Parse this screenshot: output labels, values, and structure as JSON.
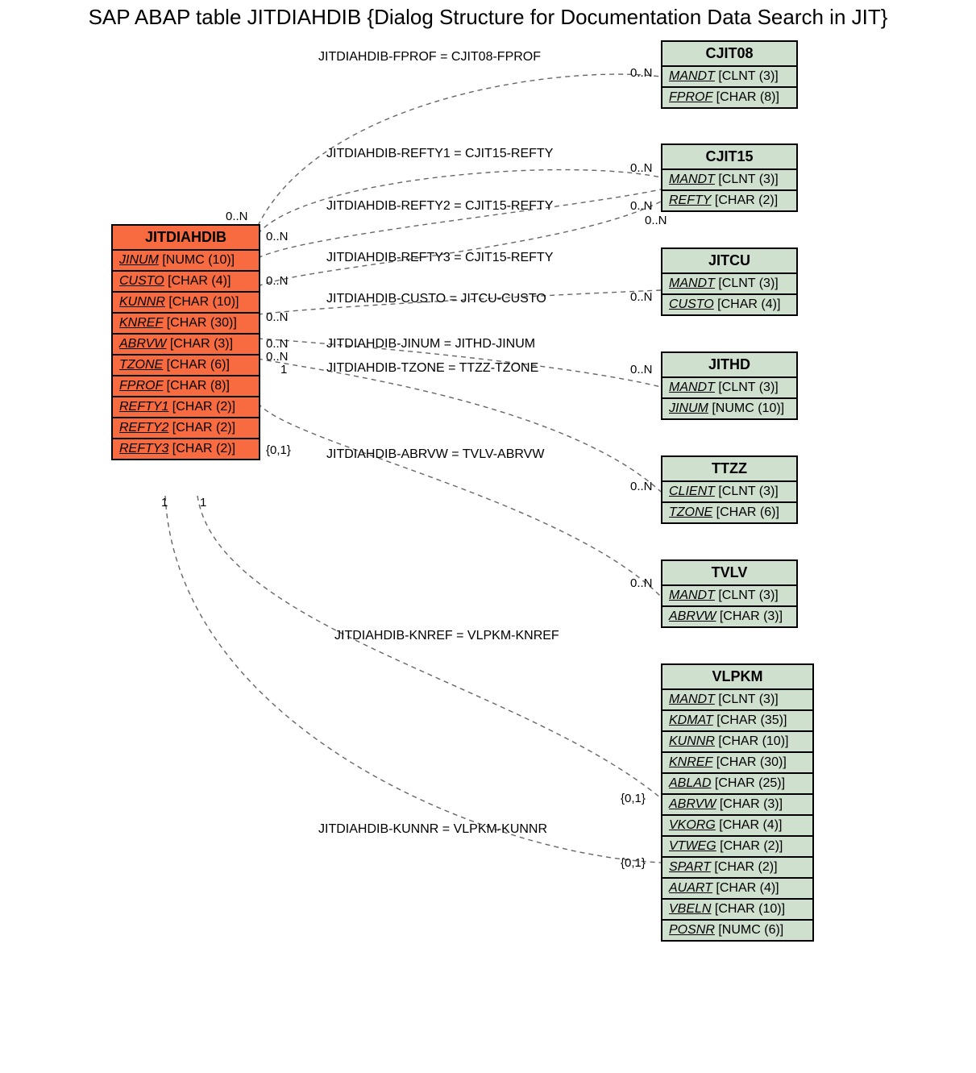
{
  "chart_data": {
    "type": "table",
    "title": "SAP ABAP table JITDIAHDIB {Dialog Structure for Documentation Data Search in JIT}",
    "main_entity": {
      "name": "JITDIAHDIB",
      "fields": [
        {
          "name": "JINUM",
          "type": "NUMC (10)"
        },
        {
          "name": "CUSTO",
          "type": "CHAR (4)"
        },
        {
          "name": "KUNNR",
          "type": "CHAR (10)"
        },
        {
          "name": "KNREF",
          "type": "CHAR (30)"
        },
        {
          "name": "ABRVW",
          "type": "CHAR (3)"
        },
        {
          "name": "TZONE",
          "type": "CHAR (6)"
        },
        {
          "name": "FPROF",
          "type": "CHAR (8)"
        },
        {
          "name": "REFTY1",
          "type": "CHAR (2)"
        },
        {
          "name": "REFTY2",
          "type": "CHAR (2)"
        },
        {
          "name": "REFTY3",
          "type": "CHAR (2)"
        }
      ]
    },
    "related_entities": [
      {
        "name": "CJIT08",
        "fields": [
          {
            "name": "MANDT",
            "type": "CLNT (3)"
          },
          {
            "name": "FPROF",
            "type": "CHAR (8)"
          }
        ]
      },
      {
        "name": "CJIT15",
        "fields": [
          {
            "name": "MANDT",
            "type": "CLNT (3)"
          },
          {
            "name": "REFTY",
            "type": "CHAR (2)"
          }
        ]
      },
      {
        "name": "JITCU",
        "fields": [
          {
            "name": "MANDT",
            "type": "CLNT (3)"
          },
          {
            "name": "CUSTO",
            "type": "CHAR (4)"
          }
        ]
      },
      {
        "name": "JITHD",
        "fields": [
          {
            "name": "MANDT",
            "type": "CLNT (3)"
          },
          {
            "name": "JINUM",
            "type": "NUMC (10)"
          }
        ]
      },
      {
        "name": "TTZZ",
        "fields": [
          {
            "name": "CLIENT",
            "type": "CLNT (3)"
          },
          {
            "name": "TZONE",
            "type": "CHAR (6)"
          }
        ]
      },
      {
        "name": "TVLV",
        "fields": [
          {
            "name": "MANDT",
            "type": "CLNT (3)"
          },
          {
            "name": "ABRVW",
            "type": "CHAR (3)"
          }
        ]
      },
      {
        "name": "VLPKM",
        "fields": [
          {
            "name": "MANDT",
            "type": "CLNT (3)"
          },
          {
            "name": "KDMAT",
            "type": "CHAR (35)"
          },
          {
            "name": "KUNNR",
            "type": "CHAR (10)"
          },
          {
            "name": "KNREF",
            "type": "CHAR (30)"
          },
          {
            "name": "ABLAD",
            "type": "CHAR (25)"
          },
          {
            "name": "ABRVW",
            "type": "CHAR (3)"
          },
          {
            "name": "VKORG",
            "type": "CHAR (4)"
          },
          {
            "name": "VTWEG",
            "type": "CHAR (2)"
          },
          {
            "name": "SPART",
            "type": "CHAR (2)"
          },
          {
            "name": "AUART",
            "type": "CHAR (4)"
          },
          {
            "name": "VBELN",
            "type": "CHAR (10)"
          },
          {
            "name": "POSNR",
            "type": "NUMC (6)"
          }
        ]
      }
    ],
    "relations": [
      {
        "label": "JITDIAHDIB-FPROF = CJIT08-FPROF",
        "left_card": "0..N",
        "right_card": "0..N"
      },
      {
        "label": "JITDIAHDIB-REFTY1 = CJIT15-REFTY",
        "left_card": "0..N",
        "right_card": "0..N"
      },
      {
        "label": "JITDIAHDIB-REFTY2 = CJIT15-REFTY",
        "left_card": "0..N",
        "right_card": "0..N"
      },
      {
        "label": "JITDIAHDIB-REFTY3 = CJIT15-REFTY",
        "left_card": "",
        "right_card": "0..N"
      },
      {
        "label": "JITDIAHDIB-CUSTO = JITCU-CUSTO",
        "left_card": "0..N",
        "right_card": "0..N"
      },
      {
        "label": "JITDIAHDIB-JINUM = JITHD-JINUM",
        "left_card": "0..N",
        "right_card": "0..N"
      },
      {
        "label": "JITDIAHDIB-TZONE = TTZZ-TZONE",
        "left_card": "1",
        "right_card": "0..N"
      },
      {
        "label": "JITDIAHDIB-ABRVW = TVLV-ABRVW",
        "left_card": "{0,1}",
        "right_card": "0..N"
      },
      {
        "label": "JITDIAHDIB-KNREF = VLPKM-KNREF",
        "left_card": "1",
        "right_card": "{0,1}"
      },
      {
        "label": "JITDIAHDIB-KUNNR = VLPKM-KUNNR",
        "left_card": "1",
        "right_card": "{0,1}"
      }
    ]
  },
  "title": "SAP ABAP table JITDIAHDIB {Dialog Structure for Documentation Data Search in JIT}",
  "main": {
    "name": "JITDIAHDIB",
    "rows": [
      {
        "f": "JINUM",
        "t": "[NUMC (10)]"
      },
      {
        "f": "CUSTO",
        "t": "[CHAR (4)]"
      },
      {
        "f": "KUNNR",
        "t": "[CHAR (10)]"
      },
      {
        "f": "KNREF",
        "t": "[CHAR (30)]"
      },
      {
        "f": "ABRVW",
        "t": "[CHAR (3)]"
      },
      {
        "f": "TZONE",
        "t": "[CHAR (6)]"
      },
      {
        "f": "FPROF",
        "t": "[CHAR (8)]"
      },
      {
        "f": "REFTY1",
        "t": "[CHAR (2)]"
      },
      {
        "f": "REFTY2",
        "t": "[CHAR (2)]"
      },
      {
        "f": "REFTY3",
        "t": "[CHAR (2)]"
      }
    ]
  },
  "ent": {
    "cjit08": {
      "name": "CJIT08",
      "rows": [
        {
          "f": "MANDT",
          "t": "[CLNT (3)]"
        },
        {
          "f": "FPROF",
          "t": "[CHAR (8)]"
        }
      ]
    },
    "cjit15": {
      "name": "CJIT15",
      "rows": [
        {
          "f": "MANDT",
          "t": "[CLNT (3)]"
        },
        {
          "f": "REFTY",
          "t": "[CHAR (2)]"
        }
      ]
    },
    "jitcu": {
      "name": "JITCU",
      "rows": [
        {
          "f": "MANDT",
          "t": "[CLNT (3)]"
        },
        {
          "f": "CUSTO",
          "t": "[CHAR (4)]"
        }
      ]
    },
    "jithd": {
      "name": "JITHD",
      "rows": [
        {
          "f": "MANDT",
          "t": "[CLNT (3)]"
        },
        {
          "f": "JINUM",
          "t": "[NUMC (10)]"
        }
      ]
    },
    "ttzz": {
      "name": "TTZZ",
      "rows": [
        {
          "f": "CLIENT",
          "t": "[CLNT (3)]"
        },
        {
          "f": "TZONE",
          "t": "[CHAR (6)]"
        }
      ]
    },
    "tvlv": {
      "name": "TVLV",
      "rows": [
        {
          "f": "MANDT",
          "t": "[CLNT (3)]"
        },
        {
          "f": "ABRVW",
          "t": "[CHAR (3)]"
        }
      ]
    },
    "vlpkm": {
      "name": "VLPKM",
      "rows": [
        {
          "f": "MANDT",
          "t": "[CLNT (3)]"
        },
        {
          "f": "KDMAT",
          "t": "[CHAR (35)]"
        },
        {
          "f": "KUNNR",
          "t": "[CHAR (10)]"
        },
        {
          "f": "KNREF",
          "t": "[CHAR (30)]"
        },
        {
          "f": "ABLAD",
          "t": "[CHAR (25)]"
        },
        {
          "f": "ABRVW",
          "t": "[CHAR (3)]"
        },
        {
          "f": "VKORG",
          "t": "[CHAR (4)]"
        },
        {
          "f": "VTWEG",
          "t": "[CHAR (2)]"
        },
        {
          "f": "SPART",
          "t": "[CHAR (2)]"
        },
        {
          "f": "AUART",
          "t": "[CHAR (4)]"
        },
        {
          "f": "VBELN",
          "t": "[CHAR (10)]"
        },
        {
          "f": "POSNR",
          "t": "[NUMC (6)]"
        }
      ]
    }
  },
  "rel": {
    "r1": "JITDIAHDIB-FPROF = CJIT08-FPROF",
    "r2": "JITDIAHDIB-REFTY1 = CJIT15-REFTY",
    "r3": "JITDIAHDIB-REFTY2 = CJIT15-REFTY",
    "r4": "JITDIAHDIB-REFTY3 = CJIT15-REFTY",
    "r5": "JITDIAHDIB-CUSTO = JITCU-CUSTO",
    "r6": "JITDIAHDIB-JINUM = JITHD-JINUM",
    "r7": "JITDIAHDIB-TZONE = TTZZ-TZONE",
    "r8": "JITDIAHDIB-ABRVW = TVLV-ABRVW",
    "r9": "JITDIAHDIB-KNREF = VLPKM-KNREF",
    "r10": "JITDIAHDIB-KUNNR = VLPKM-KUNNR"
  },
  "card": {
    "l_top": "0..N",
    "l_r2": "0..N",
    "l_r3": "0..N",
    "l_r5": "0..N",
    "l_r6a": "0..N",
    "l_r6b": "0..N",
    "l_r7": "1",
    "l_r8": "{0,1}",
    "l_b1": "1",
    "l_b2": "1",
    "rc1": "0..N",
    "rc2": "0..N",
    "rc3": "0..N",
    "rc4": "0..N",
    "rc5": "0..N",
    "rc6": "0..N",
    "rc7": "0..N",
    "rc8": "0..N",
    "rc9": "{0,1}",
    "rc10": "{0,1}"
  }
}
